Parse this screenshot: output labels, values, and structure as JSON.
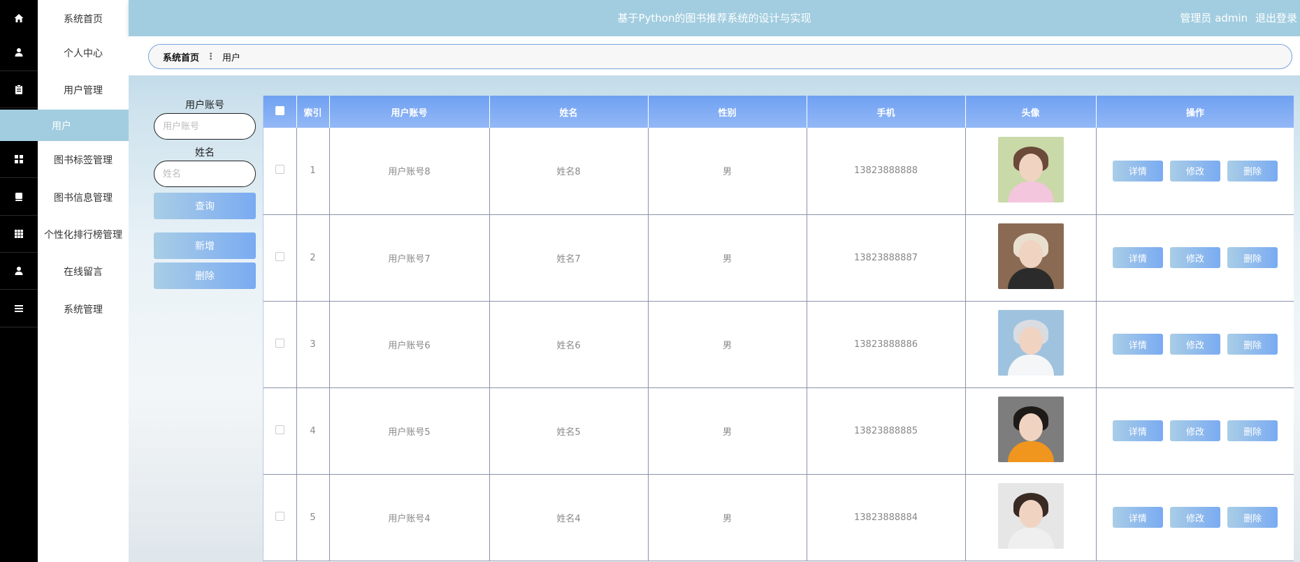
{
  "header": {
    "title": "基于Python的图书推荐系统的设计与实现",
    "user_label": "管理员 admin",
    "logout_label": "退出登录"
  },
  "sidebar": {
    "items": [
      {
        "label": "系统首页",
        "icon": "home-icon"
      },
      {
        "label": "个人中心",
        "icon": "user-icon"
      },
      {
        "label": "用户管理",
        "icon": "clipboard-icon"
      },
      {
        "label": "图书标签管理",
        "icon": "grid-icon"
      },
      {
        "label": "图书信息管理",
        "icon": "book-icon"
      },
      {
        "label": "个性化排行榜管理",
        "icon": "apps-icon"
      },
      {
        "label": "在线留言",
        "icon": "user-icon"
      },
      {
        "label": "系统管理",
        "icon": "menu-icon"
      }
    ],
    "active_sub": "用户"
  },
  "breadcrumb": {
    "home": "系统首页",
    "separator": "⋮",
    "current": "用户"
  },
  "search": {
    "account_label": "用户账号",
    "account_placeholder": "用户账号",
    "name_label": "姓名",
    "name_placeholder": "姓名",
    "query_button": "查询",
    "add_button": "新增",
    "delete_button": "删除"
  },
  "table": {
    "columns": [
      "索引",
      "用户账号",
      "姓名",
      "性别",
      "手机",
      "头像",
      "操作"
    ],
    "rows": [
      {
        "index": "1",
        "account": "用户账号8",
        "name": "姓名8",
        "gender": "男",
        "phone": "13823888888"
      },
      {
        "index": "2",
        "account": "用户账号7",
        "name": "姓名7",
        "gender": "男",
        "phone": "13823888887"
      },
      {
        "index": "3",
        "account": "用户账号6",
        "name": "姓名6",
        "gender": "男",
        "phone": "13823888886"
      },
      {
        "index": "4",
        "account": "用户账号5",
        "name": "姓名5",
        "gender": "男",
        "phone": "13823888885"
      },
      {
        "index": "5",
        "account": "用户账号4",
        "name": "姓名4",
        "gender": "男",
        "phone": "13823888884"
      }
    ],
    "actions": {
      "detail": "详情",
      "edit": "修改",
      "delete": "删除"
    }
  },
  "colors": {
    "accent": "#a2cde0",
    "table_header": "#7aabf2",
    "sidebar_icons_bg": "#000000"
  }
}
